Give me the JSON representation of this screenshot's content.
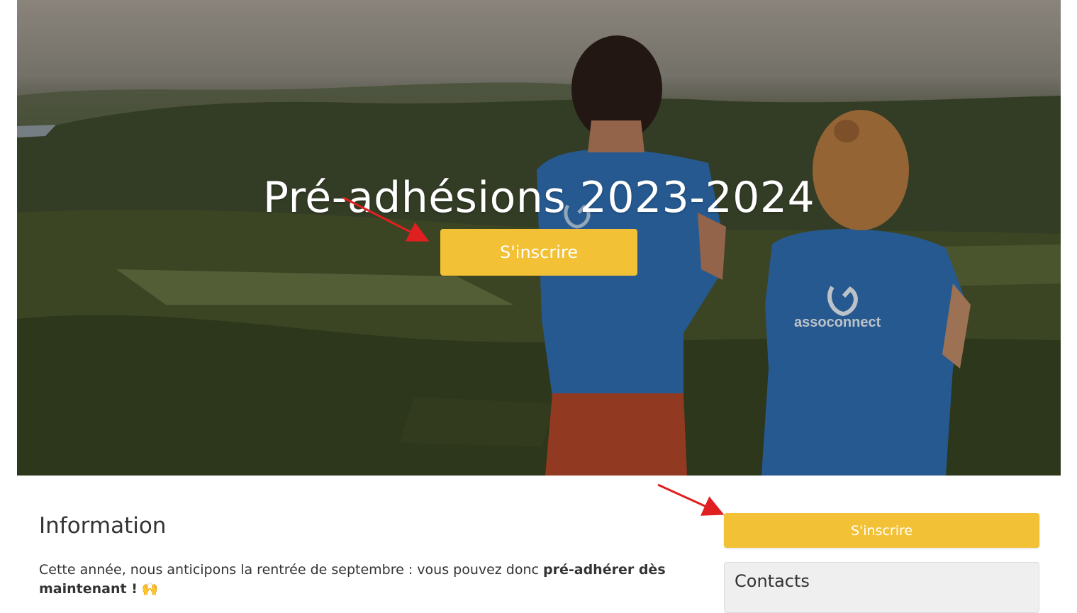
{
  "hero": {
    "title": "Pré-adhésions 2023-2024",
    "cta_label": "S'inscrire",
    "shirt_brand": "assoconnect"
  },
  "info": {
    "heading": "Information",
    "text_before": "Cette année, nous anticipons la rentrée de septembre : vous pouvez donc ",
    "text_bold": "pré-adhérer dès maintenant !",
    "text_emoji": "🙌"
  },
  "sidebar": {
    "cta_label": "S'inscrire",
    "contacts_heading": "Contacts"
  },
  "colors": {
    "accent": "#f3c135",
    "annotation_arrow": "#e02020"
  },
  "icons": [
    "assoconnect-logo-icon",
    "annotation-arrow-icon"
  ]
}
